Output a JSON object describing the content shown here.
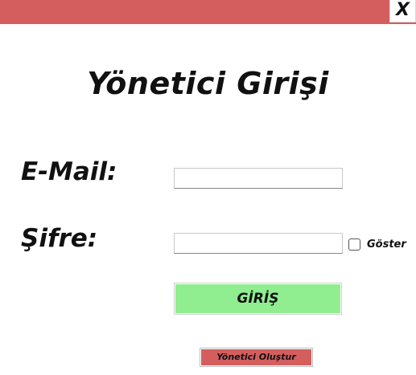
{
  "window": {
    "close_label": "X",
    "titlebar_color": "#d45e5e"
  },
  "form": {
    "title": "Yönetici Girişi",
    "email_label": "E-Mail:",
    "email_value": "",
    "password_label": "Şifre:",
    "password_value": "",
    "show_label": "Göster",
    "show_checked": false,
    "login_label": "GİRİŞ",
    "login_color": "#90ee90",
    "create_label": "Yönetici Oluştur",
    "create_color": "#d45e5e"
  }
}
